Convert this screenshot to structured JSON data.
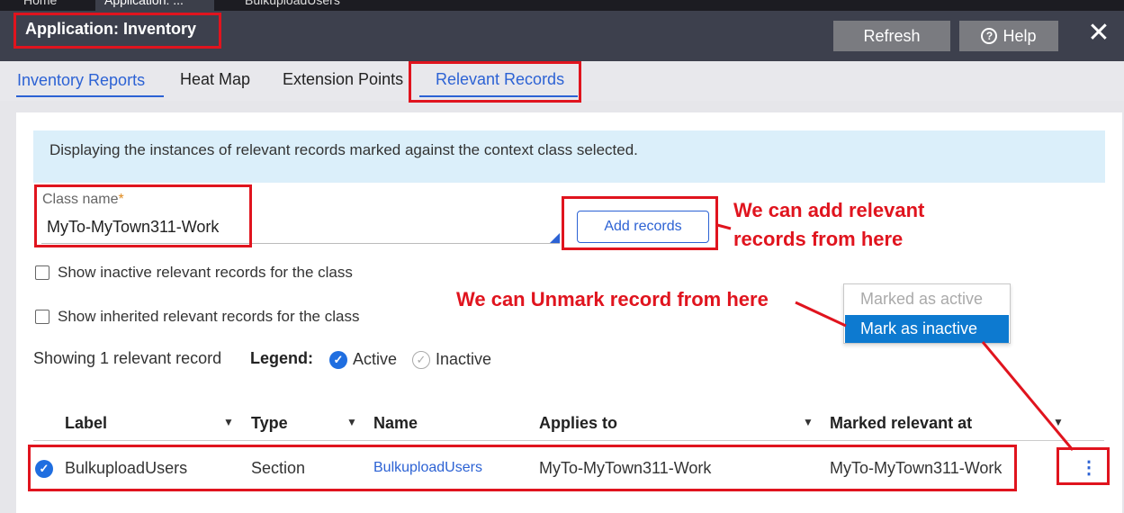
{
  "top_tabs": [
    "Home",
    "Application: ...",
    "BulkuploadUsers"
  ],
  "header": {
    "title": "Application: Inventory",
    "refresh_label": "Refresh",
    "help_label": "Help",
    "close_glyph": "✕"
  },
  "nav_tabs": [
    "Inventory Reports",
    "Heat Map",
    "Extension Points",
    "Relevant Records"
  ],
  "info_text": "Displaying the instances of relevant records marked against the context class selected.",
  "class_field": {
    "label": "Class name",
    "required_mark": "*",
    "value": "MyTo-MyTown311-Work"
  },
  "add_records_label": "Add records",
  "checkboxes": [
    "Show inactive relevant records for the class",
    "Show inherited relevant records for the class"
  ],
  "showing_text": "Showing 1 relevant record",
  "legend": {
    "label": "Legend:",
    "active": "Active",
    "inactive": "Inactive"
  },
  "table": {
    "columns": [
      "Label",
      "Type",
      "Name",
      "Applies to",
      "Marked relevant at"
    ],
    "rows": [
      {
        "label": "BulkuploadUsers",
        "type": "Section",
        "name": "BulkuploadUsers",
        "applies_to": "MyTo-MyTown311-Work",
        "marked_at": "MyTo-MyTown311-Work",
        "status": "active"
      }
    ]
  },
  "menu": {
    "items": [
      "Marked as active",
      "Mark as inactive"
    ]
  },
  "annotations": {
    "add_note_line1": "We can add relevant",
    "add_note_line2": "records from here",
    "unmark_note": "We can Unmark record from here"
  },
  "colors": {
    "accent": "#2c62d4",
    "annotation": "#e0141e",
    "header_bg": "#3d404d",
    "menu_highlight": "#0d7ad0"
  }
}
